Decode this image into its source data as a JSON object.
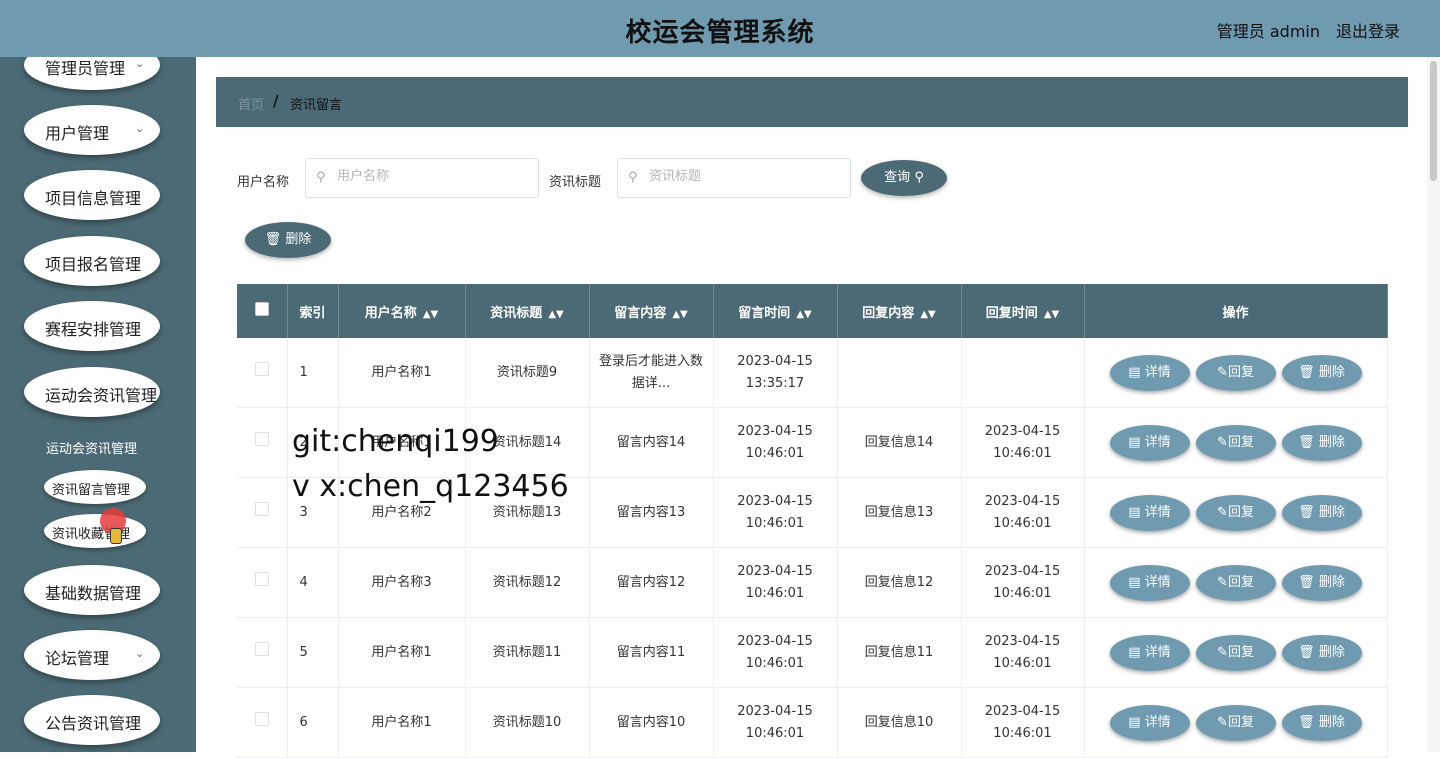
{
  "header": {
    "title": "校运会管理系统",
    "user": "管理员 admin",
    "logout": "退出登录"
  },
  "sidebar": {
    "items": [
      {
        "label": "管理员管理",
        "chevron": true
      },
      {
        "label": "用户管理",
        "chevron": true
      },
      {
        "label": "项目信息管理",
        "chevron": false
      },
      {
        "label": "项目报名管理",
        "chevron": false
      },
      {
        "label": "赛程安排管理",
        "chevron": false
      },
      {
        "label": "运动会资讯管理",
        "chevron": false
      },
      {
        "label": "基础数据管理",
        "chevron": false
      },
      {
        "label": "论坛管理",
        "chevron": true
      },
      {
        "label": "公告资讯管理",
        "chevron": false
      }
    ],
    "sub_active": "运动会资讯管理",
    "sub_items": [
      "资讯留言管理",
      "资讯收藏管理"
    ]
  },
  "breadcrumb": {
    "home": "首页",
    "sep": "/",
    "current": "资讯留言"
  },
  "search": {
    "user_label": "用户名称",
    "user_placeholder": "用户名称",
    "title_label": "资讯标题",
    "title_placeholder": "资讯标题",
    "query_button": "查询"
  },
  "toolbar": {
    "delete_button": "删除"
  },
  "table": {
    "columns": [
      "索引",
      "用户名称",
      "资讯标题",
      "留言内容",
      "留言时间",
      "回复内容",
      "回复时间",
      "操作"
    ],
    "rows": [
      {
        "index": "1",
        "user": "用户名称1",
        "title": "资讯标题9",
        "content": "登录后才能进入数据详...",
        "time": "2023-04-15 13:35:17",
        "reply": "",
        "reply_time": ""
      },
      {
        "index": "2",
        "user": "用户名称1",
        "title": "资讯标题14",
        "content": "留言内容14",
        "time": "2023-04-15 10:46:01",
        "reply": "回复信息14",
        "reply_time": "2023-04-15 10:46:01"
      },
      {
        "index": "3",
        "user": "用户名称2",
        "title": "资讯标题13",
        "content": "留言内容13",
        "time": "2023-04-15 10:46:01",
        "reply": "回复信息13",
        "reply_time": "2023-04-15 10:46:01"
      },
      {
        "index": "4",
        "user": "用户名称3",
        "title": "资讯标题12",
        "content": "留言内容12",
        "time": "2023-04-15 10:46:01",
        "reply": "回复信息12",
        "reply_time": "2023-04-15 10:46:01"
      },
      {
        "index": "5",
        "user": "用户名称1",
        "title": "资讯标题11",
        "content": "留言内容11",
        "time": "2023-04-15 10:46:01",
        "reply": "回复信息11",
        "reply_time": "2023-04-15 10:46:01"
      },
      {
        "index": "6",
        "user": "用户名称1",
        "title": "资讯标题10",
        "content": "留言内容10",
        "time": "2023-04-15 10:46:01",
        "reply": "回复信息10",
        "reply_time": "2023-04-15 10:46:01"
      }
    ],
    "actions": {
      "detail": "详情",
      "reply": "回复",
      "delete": "删除"
    }
  },
  "watermark": {
    "line1": "git:chenqi199",
    "line2": "v x:chen_q123456"
  },
  "colors": {
    "header": "#6f9aaf",
    "sidebar": "#4c6a75",
    "button": "#4c6a75",
    "row_button": "#6f9aaf"
  }
}
